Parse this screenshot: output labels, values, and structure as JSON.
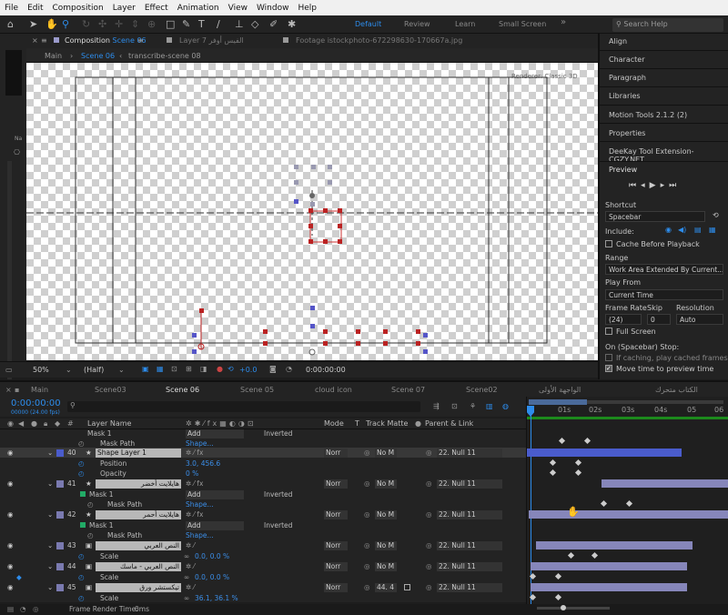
{
  "menu": [
    "File",
    "Edit",
    "Composition",
    "Layer",
    "Effect",
    "Animation",
    "View",
    "Window",
    "Help"
  ],
  "workspaces": {
    "default": "Default",
    "review": "Review",
    "learn": "Learn",
    "small": "Small Screen"
  },
  "search_placeholder": "Search Help",
  "comp_panel": {
    "tab_prefix": "Composition",
    "tab_name": "Scene 06",
    "layer_tab": "Layer 7 الفيس أوفر",
    "footage_tab": "Footage istockphoto-672298630-170667a.jpg",
    "subtabs": [
      "Main",
      "Scene 06",
      "transcribe-scene 08"
    ],
    "renderer": "Renderer: Classic 3D"
  },
  "viewer_bar": {
    "zoom": "50%",
    "quality": "(Half)",
    "exposure": "+0.0",
    "timecode": "0:00:00:00"
  },
  "right_panel": {
    "items": [
      "Align",
      "Character",
      "Paragraph",
      "Libraries",
      "Motion Tools 2.1.2 (2)",
      "Properties",
      "DeeKay Tool Extension-CGZY.NET"
    ],
    "preview_title": "Preview",
    "shortcut_label": "Shortcut",
    "shortcut_value": "Spacebar",
    "include_label": "Include:",
    "cache_label": "Cache Before Playback",
    "range_label": "Range",
    "range_value": "Work Area Extended By Current...",
    "playfrom_label": "Play From",
    "playfrom_value": "Current Time",
    "framerate_label": "Frame Rate",
    "skip_label": "Skip",
    "resolution_label": "Resolution",
    "framerate_value": "(24)",
    "skip_value": "0",
    "resolution_value": "Auto",
    "fullscreen_label": "Full Screen",
    "onstop_label": "On (Spacebar) Stop:",
    "ifcaching_label": "If caching, play cached frames",
    "movetime_label": "Move time to preview time"
  },
  "timeline_tabs": [
    "Main",
    "Scene03",
    "Scene 06",
    "Scene 05",
    "cloud icon",
    "Scene 07",
    "Scene02",
    "الواجهة الأولى",
    "الكتاب متحرك"
  ],
  "timeline": {
    "timecode": "0:00:00:00",
    "fps": "00000 (24.00 fps)",
    "search_placeholder": "",
    "columns": {
      "layer_name": "Layer Name",
      "mode": "Mode",
      "t": "T",
      "track_matte": "Track Matte",
      "parent": "Parent & Link"
    },
    "ruler": [
      "0s",
      "01s",
      "02s",
      "03s",
      "04s",
      "05",
      "06"
    ],
    "rows": [
      {
        "num": "",
        "name": "Mask Path",
        "type": "prop",
        "value": "Shape...",
        "mode": "",
        "parent": ""
      },
      {
        "num": "40",
        "name": "Shape Layer 1",
        "type": "layer",
        "value": "",
        "mode": "Norr",
        "matte": "No M",
        "parent": "22. Null 11"
      },
      {
        "num": "",
        "name": "Position",
        "type": "prop",
        "value": "3.0, 456.6",
        "mode": "",
        "parent": ""
      },
      {
        "num": "",
        "name": "Opacity",
        "type": "prop",
        "value": "0 %",
        "mode": "",
        "parent": ""
      },
      {
        "num": "41",
        "name": "هايلايت أخضر",
        "type": "layer",
        "value": "",
        "mode": "Norr",
        "matte": "No M",
        "parent": "22. Null 11"
      },
      {
        "num": "",
        "name": "Mask 1",
        "type": "mask",
        "value": "Add",
        "extra": "Inverted",
        "mode": "",
        "parent": ""
      },
      {
        "num": "",
        "name": "Mask Path",
        "type": "prop",
        "value": "Shape...",
        "mode": "",
        "parent": ""
      },
      {
        "num": "42",
        "name": "هايلايت أحمر",
        "type": "layer",
        "value": "",
        "mode": "Norr",
        "matte": "No M",
        "parent": "22. Null 11"
      },
      {
        "num": "",
        "name": "Mask 1",
        "type": "mask",
        "value": "Add",
        "extra": "Inverted",
        "mode": "",
        "parent": ""
      },
      {
        "num": "",
        "name": "Mask Path",
        "type": "prop",
        "value": "Shape...",
        "mode": "",
        "parent": ""
      },
      {
        "num": "43",
        "name": "النص العربي",
        "type": "layer",
        "value": "",
        "mode": "Norr",
        "matte": "No M",
        "parent": "22. Null 11"
      },
      {
        "num": "",
        "name": "Scale",
        "type": "prop",
        "value": "0.0, 0.0 %",
        "mode": "",
        "parent": ""
      },
      {
        "num": "44",
        "name": "النص العربي - ماسك",
        "type": "layer",
        "value": "",
        "mode": "Norr",
        "matte": "No M",
        "parent": "22. Null 11"
      },
      {
        "num": "",
        "name": "Scale",
        "type": "prop",
        "value": "0.0, 0.0 %",
        "mode": "",
        "parent": ""
      },
      {
        "num": "45",
        "name": "تيكستشر ورق",
        "type": "layer",
        "value": "",
        "mode": "Norr",
        "matte": "44. 4",
        "parent": "22. Null 11"
      },
      {
        "num": "",
        "name": "Scale",
        "type": "prop",
        "value": "36.1, 36.1 %",
        "mode": "",
        "parent": ""
      }
    ],
    "header_mask": {
      "name": "Mask 1",
      "value": "Add",
      "extra": "Inverted"
    }
  },
  "status": {
    "label": "Frame Render Time:",
    "value": "0ms"
  }
}
